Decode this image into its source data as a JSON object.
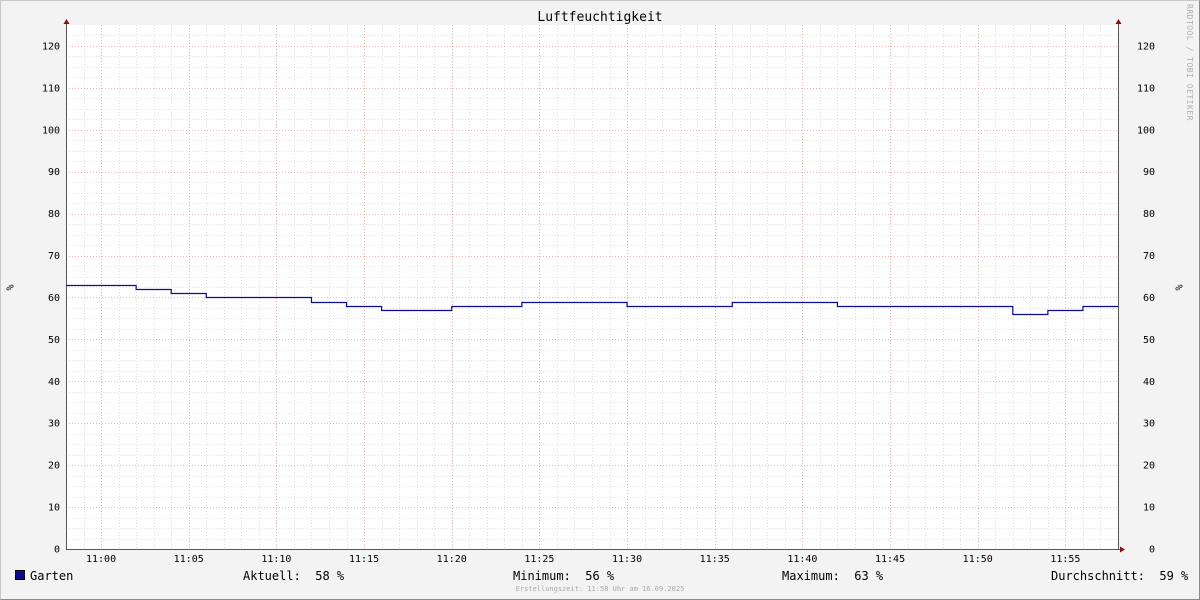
{
  "chart_data": {
    "type": "line",
    "title": "Luftfeuchtigkeit",
    "ylabel": "%",
    "ylim": [
      0,
      125
    ],
    "yticks": [
      0,
      10,
      20,
      30,
      40,
      50,
      60,
      70,
      80,
      90,
      100,
      110,
      120
    ],
    "xlim": [
      "10:58",
      "11:58"
    ],
    "xticks": [
      "11:00",
      "11:05",
      "11:10",
      "11:15",
      "11:20",
      "11:25",
      "11:30",
      "11:35",
      "11:40",
      "11:45",
      "11:50",
      "11:55"
    ],
    "grid": true,
    "series": [
      {
        "name": "Garten",
        "color": "#0c0c91",
        "step": true,
        "x": [
          "10:58",
          "11:02",
          "11:04",
          "11:06",
          "11:12",
          "11:14",
          "11:16",
          "11:20",
          "11:24",
          "11:30",
          "11:36",
          "11:42",
          "11:52",
          "11:54",
          "11:56",
          "11:58"
        ],
        "y": [
          63,
          62,
          61,
          60,
          59,
          58,
          57,
          58,
          59,
          58,
          59,
          58,
          56,
          57,
          58,
          58
        ]
      }
    ]
  },
  "legend": {
    "series_name": "Garten",
    "swatch_color": "#0c0c91",
    "aktuell": "Aktuell:  58 %",
    "minimum": "Minimum:  56 %",
    "maximum": "Maximum:  63 %",
    "durchschnitt": "Durchschnitt:  59 %"
  },
  "watermark": "RRDTOOL / TOBI OETIKER",
  "footer": "Erstellungszeit: 11:58 Uhr am 16.09.2025",
  "colors": {
    "minor_grid": "#c6c6c6",
    "major_grid": "#e8a0a0",
    "axis": "#555555",
    "arrow": "#8b1010"
  }
}
